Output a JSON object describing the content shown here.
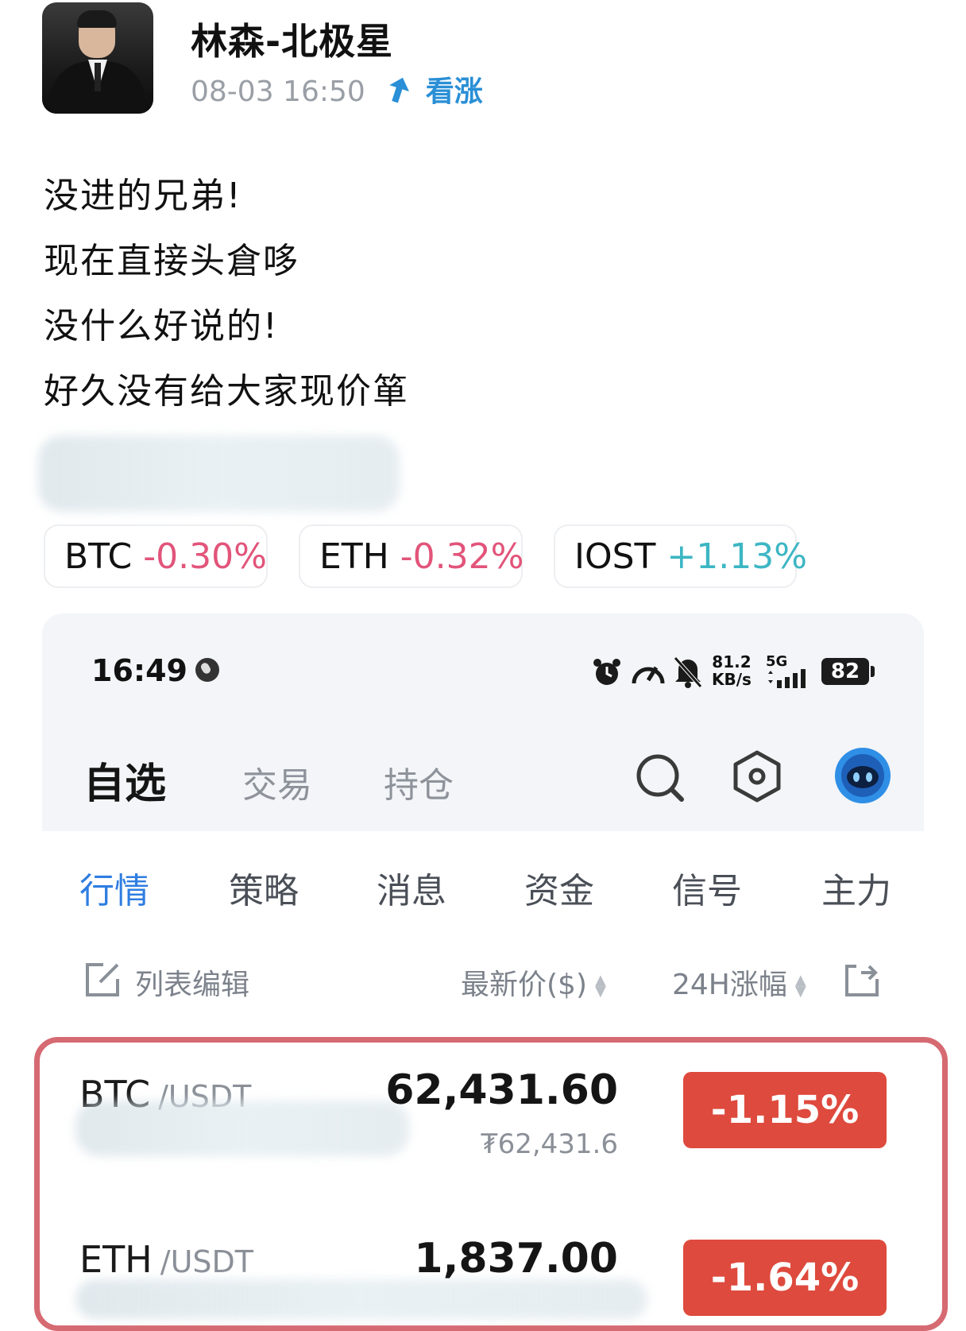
{
  "post": {
    "author": "林森-北极星",
    "date": "08-03 16:50",
    "sentiment_icon": "up-arrow-icon",
    "sentiment": "看涨",
    "lines": [
      "没进的兄弟!",
      "现在直接头倉哆",
      "没什么好说的!",
      "好久没有给大家现价箪"
    ]
  },
  "tickers": [
    {
      "symbol": "BTC",
      "change": "-0.30%"
    },
    {
      "symbol": "ETH",
      "change": "-0.32%"
    },
    {
      "symbol": "IOST",
      "change": "+1.13%"
    }
  ],
  "phone": {
    "status": {
      "time": "16:49",
      "speed_value": "81.2",
      "speed_unit": "KB/s",
      "network": "5G",
      "battery": "82"
    },
    "tabs": {
      "active": "自选",
      "trade": "交易",
      "position": "持仓"
    },
    "subtabs": [
      "行情",
      "策略",
      "消息",
      "资金",
      "信号",
      "主力"
    ],
    "columns": {
      "edit": "列表编辑",
      "price": "最新价($)",
      "change": "24H涨幅"
    },
    "rows": [
      {
        "base": "BTC",
        "quote": "/USDT",
        "price": "62,431.60",
        "fiat": "₮62,431.6",
        "change": "-1.15%"
      },
      {
        "base": "ETH",
        "quote": "/USDT",
        "price": "1,837.00",
        "change": "-1.64%"
      }
    ]
  },
  "colors": {
    "accent": "#2f7de1",
    "negative": "#de4a3d",
    "ticker_negative": "#e2547a",
    "ticker_positive": "#3db6c4",
    "highlight_border": "#d66a72"
  }
}
